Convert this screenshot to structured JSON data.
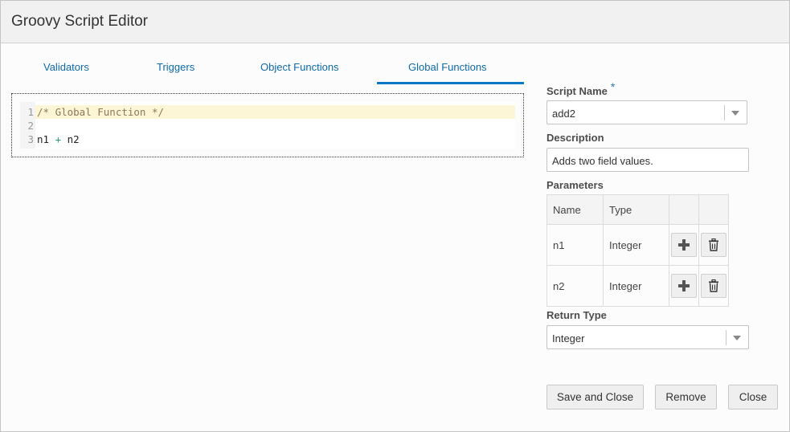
{
  "dialog": {
    "title": "Groovy Script Editor"
  },
  "tabs": [
    {
      "label": "Validators",
      "selected": false
    },
    {
      "label": "Triggers",
      "selected": false
    },
    {
      "label": "Object Functions",
      "selected": false
    },
    {
      "label": "Global Functions",
      "selected": true
    }
  ],
  "editor": {
    "lines": [
      {
        "number": "1",
        "parts": [
          {
            "text": "/* Global Function */",
            "type": "comment"
          }
        ]
      },
      {
        "number": "2",
        "parts": []
      },
      {
        "number": "3",
        "parts": [
          {
            "text": "n1 ",
            "type": "text"
          },
          {
            "text": "+",
            "type": "op"
          },
          {
            "text": " n2",
            "type": "text"
          }
        ]
      }
    ],
    "line_1": {
      "number": "1",
      "text": "/* Global Function */"
    },
    "line_2": {
      "number": "2",
      "text": ""
    },
    "line_3": {
      "number": "3",
      "text_a": "n1 ",
      "op": "+",
      "text_b": " n2"
    }
  },
  "form": {
    "script_name": {
      "label": "Script Name",
      "required_marker": "*",
      "value": "add2"
    },
    "description": {
      "label": "Description",
      "value": "Adds two field values."
    },
    "parameters": {
      "label": "Parameters",
      "columns": [
        "Name",
        "Type",
        "",
        ""
      ],
      "rows": [
        {
          "name": "n1",
          "type": "Integer"
        },
        {
          "name": "n2",
          "type": "Integer"
        }
      ]
    },
    "return_type": {
      "label": "Return Type",
      "value": "Integer"
    }
  },
  "buttons": {
    "save_and_close": "Save and Close",
    "remove": "Remove",
    "close": "Close"
  },
  "colors": {
    "accent": "#0a78c2",
    "tab_text": "#0e6aa8",
    "active_line": "#fdf6d6"
  }
}
